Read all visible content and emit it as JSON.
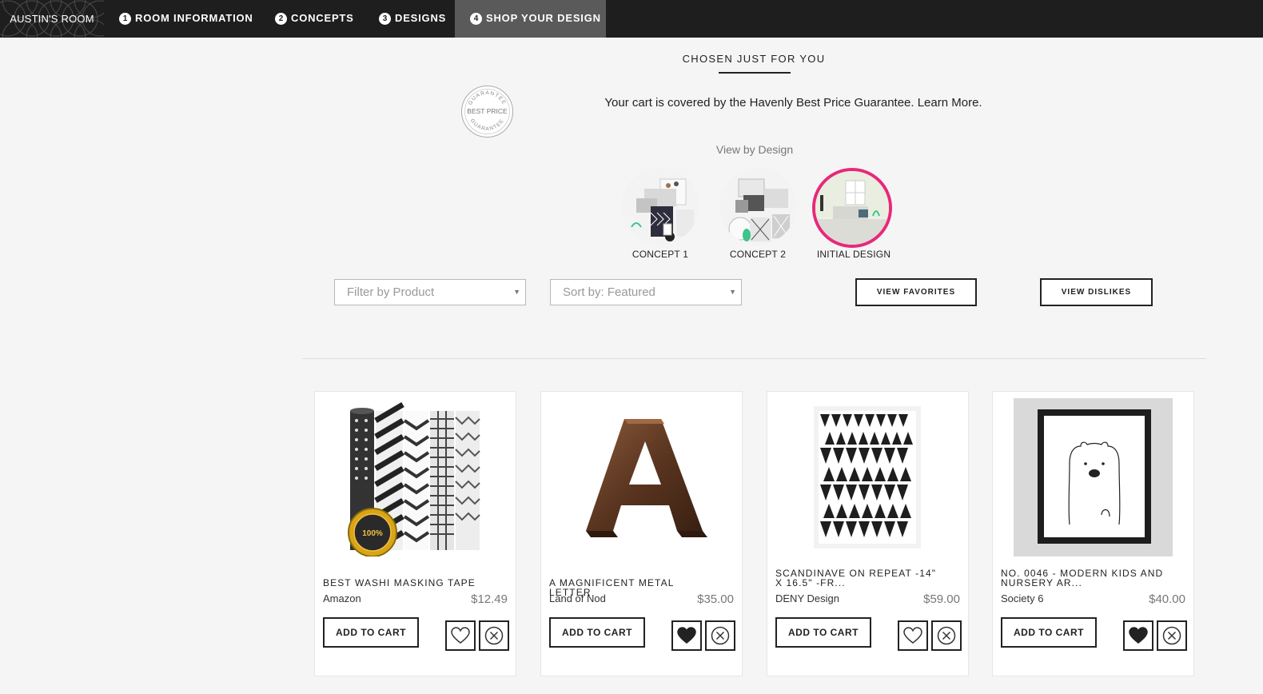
{
  "nav": {
    "room": "AUSTIN'S ROOM",
    "steps": [
      {
        "num": "1",
        "label": "ROOM INFORMATION",
        "active": false
      },
      {
        "num": "2",
        "label": "CONCEPTS",
        "active": false
      },
      {
        "num": "3",
        "label": "DESIGNS",
        "active": false
      },
      {
        "num": "4",
        "label": "SHOP YOUR DESIGN",
        "active": true
      }
    ]
  },
  "header": {
    "title": "CHOSEN JUST FOR YOU",
    "seal": {
      "top": "GUARANTEE",
      "center": "BEST PRICE",
      "bottom": "GUARANTEE"
    },
    "guarantee_text": "Your cart is covered by the Havenly Best Price Guarantee. Learn More.",
    "view_by": "View by Design"
  },
  "designs": [
    {
      "label": "CONCEPT 1",
      "selected": false
    },
    {
      "label": "CONCEPT 2",
      "selected": false
    },
    {
      "label": "INITIAL DESIGN",
      "selected": true
    }
  ],
  "filters": {
    "filter_product": "Filter by Product",
    "sort": "Sort by: Featured",
    "view_favorites": "VIEW FAVORITES",
    "view_dislikes": "VIEW DISLIKES"
  },
  "products": [
    {
      "name": "BEST WASHI MASKING TAPE",
      "vendor": "Amazon",
      "price": "$12.49",
      "favorited": false,
      "cart_label": "ADD TO CART"
    },
    {
      "name": "A MAGNIFICENT METAL LETTER",
      "vendor": "Land of Nod",
      "price": "$35.00",
      "favorited": true,
      "cart_label": "ADD TO CART"
    },
    {
      "name": "SCANDINAVE ON REPEAT -14\" X 16.5\" -FR...",
      "vendor": "DENY Design",
      "price": "$59.00",
      "favorited": false,
      "cart_label": "ADD TO CART"
    },
    {
      "name": "NO. 0046 - MODERN KIDS AND NURSERY AR...",
      "vendor": "Society 6",
      "price": "$40.00",
      "favorited": true,
      "cart_label": "ADD TO CART"
    }
  ],
  "badge_text": "100%",
  "colors": {
    "accent": "#e8287a",
    "nav_bg": "#1e1e1e",
    "nav_active": "#5a5a5a"
  }
}
